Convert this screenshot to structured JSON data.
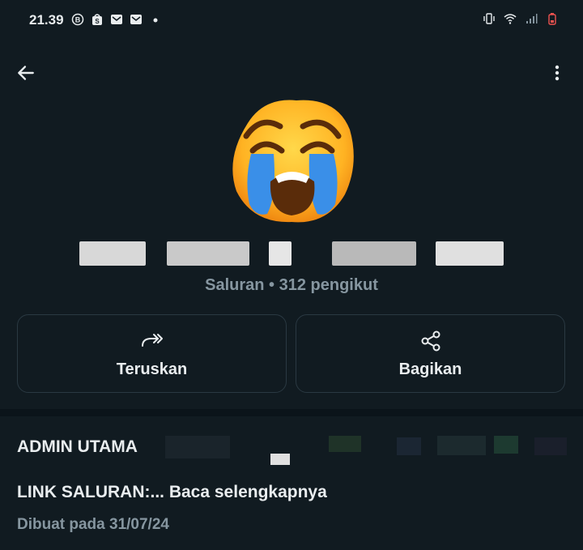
{
  "status_bar": {
    "time": "21.39",
    "left_icons": [
      "b-badge-icon",
      "shopping-bag-icon",
      "mail-icon",
      "mail-icon",
      "dot-icon"
    ],
    "right_icons": [
      "vibrate-icon",
      "wifi-icon",
      "signal-icon",
      "battery-low-icon"
    ]
  },
  "header": {
    "back_icon": "arrow-left-icon",
    "menu_icon": "more-vertical-icon",
    "avatar": "crying-face-emoji",
    "subtitle": "Saluran • 312 pengikut"
  },
  "actions": [
    {
      "label": "Teruskan",
      "icon": "forward-icon"
    },
    {
      "label": "Bagikan",
      "icon": "share-icon"
    }
  ],
  "description": {
    "line1": "ADMIN UTAMA",
    "line2": "LINK SALURAN:...",
    "read_more": " Baca selengkapnya",
    "created": "Dibuat pada 31/07/24"
  },
  "colors": {
    "background": "#0b141a",
    "panel": "#111b21",
    "text": "#e9edef",
    "muted": "#8696a0",
    "border": "#2a3942"
  }
}
